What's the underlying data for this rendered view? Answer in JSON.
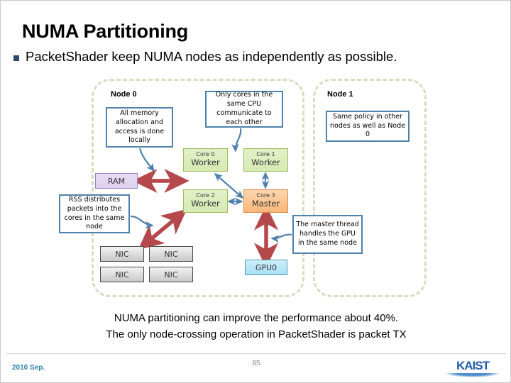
{
  "slide": {
    "title": "NUMA Partitioning",
    "bullet": "PacketShader keep NUMA nodes as independently as possible.",
    "bullet_glyph": "square-bullet"
  },
  "diagram": {
    "node0_label": "Node 0",
    "node1_label": "Node 1",
    "callouts": {
      "memory": "All memory allocation and access is done locally",
      "cores": "Only cores in the same CPU communicate to each other",
      "policy": "Same policy in other nodes as well as Node 0",
      "rss": "RSS distributes packets into the cores in the same node",
      "master": "The master thread handles the GPU in the same node"
    },
    "ram_label": "RAM",
    "cores": [
      {
        "id": "Core 0",
        "role": "Worker"
      },
      {
        "id": "Core 1",
        "role": "Worker"
      },
      {
        "id": "Core 2",
        "role": "Worker"
      },
      {
        "id": "Core 3",
        "role": "Master"
      }
    ],
    "nics": [
      "NIC",
      "NIC",
      "NIC",
      "NIC"
    ],
    "gpu_label": "GPU0",
    "colors": {
      "worker_fill": "#d6eab3",
      "worker_border": "#9cbb5a",
      "master_fill": "#f9b77a",
      "master_border": "#e08a45",
      "ram_fill": "#ddd0ee",
      "ram_border": "#9b7fc0",
      "gpu_fill": "#a9e0f4",
      "gpu_border": "#4e9ab0",
      "nic_fill": "#c9c9c9",
      "nic_border": "#4a4a4a",
      "callout_border": "#4e81ac",
      "node_boundary": "#d9dcc0",
      "red_arrow": "#b4484a",
      "blue_arrow": "#4e81ac"
    }
  },
  "conclusion": {
    "line1": "NUMA partitioning can improve the performance about 40%.",
    "line2": "The only node-crossing operation in PacketShader is packet TX"
  },
  "footer": {
    "date": "2010 Sep.",
    "page": "85",
    "logo": "KAIST"
  }
}
